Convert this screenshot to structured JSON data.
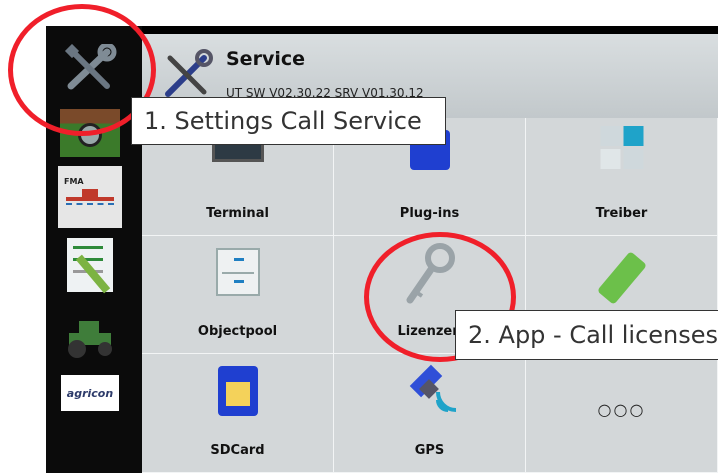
{
  "header": {
    "title": "Service",
    "subtitle": "UT SW V02.30.22 SRV V01.30.12"
  },
  "sidebar": {
    "items": [
      {
        "name": "service",
        "icon": "tools-icon"
      },
      {
        "name": "field-nav",
        "icon": "field-navigation-icon"
      },
      {
        "name": "fma",
        "icon": "sprayer-icon",
        "label": "FMA"
      },
      {
        "name": "tasks",
        "icon": "checklist-icon"
      },
      {
        "name": "tractor",
        "icon": "tractor-icon"
      },
      {
        "name": "agricon",
        "icon": "agricon-logo",
        "label": "agricon"
      }
    ]
  },
  "tiles": [
    {
      "label": "Terminal",
      "icon": "terminal-icon"
    },
    {
      "label": "Plug-ins",
      "icon": "puzzle-icon"
    },
    {
      "label": "Treiber",
      "icon": "driver-icon"
    },
    {
      "label": "Objectpool",
      "icon": "filing-cabinet-icon"
    },
    {
      "label": "Lizenzen",
      "icon": "key-icon"
    },
    {
      "label": "",
      "icon": "usb-stick-icon"
    },
    {
      "label": "SDCard",
      "icon": "sd-card-icon"
    },
    {
      "label": "GPS",
      "icon": "satellite-icon"
    },
    {
      "label": "○○○",
      "icon": "more-icon"
    }
  ],
  "callouts": {
    "step1": "1. Settings Call Service",
    "step2": "2. App - Call licenses"
  },
  "colors": {
    "annotation_ring": "#f01f2a",
    "panel_bg": "#c9cfd2"
  }
}
